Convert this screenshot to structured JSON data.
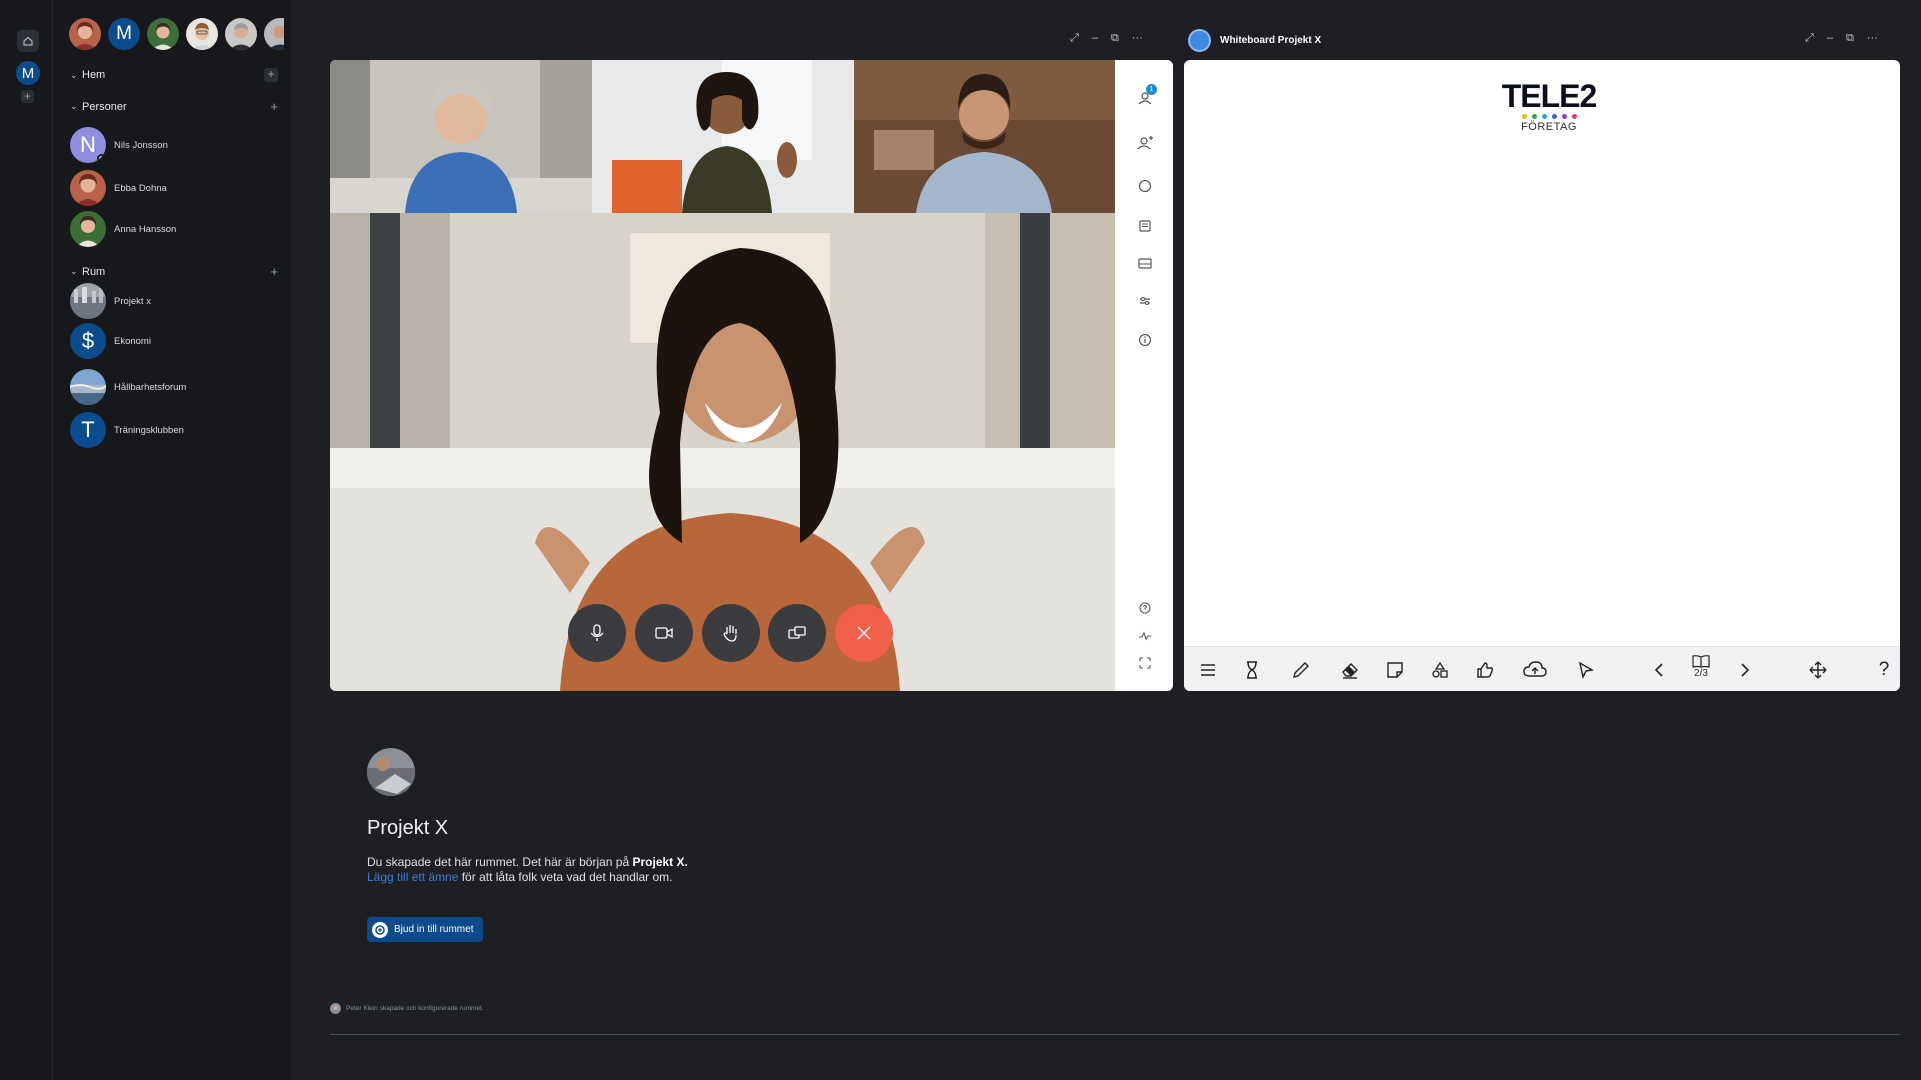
{
  "sidebar": {
    "rail_user_initial": "M",
    "top_avatar_initial": "M",
    "sections": {
      "hem": {
        "label": "Hem"
      },
      "personer": {
        "label": "Personer"
      },
      "rum": {
        "label": "Rum"
      }
    },
    "people": [
      {
        "name": "Nils Jonsson",
        "initial": "N"
      },
      {
        "name": "Ebba Dohna"
      },
      {
        "name": "Anna Hansson"
      }
    ],
    "rooms": [
      {
        "name": "Projekt x"
      },
      {
        "name": "Ekonomi",
        "icon_glyph": "$"
      },
      {
        "name": "Hållbarhetsforum"
      },
      {
        "name": "Träningsklubben",
        "initial": "T"
      }
    ]
  },
  "call": {
    "participants_badge": "1",
    "controls": [
      "microphone",
      "camera",
      "raise-hand",
      "share-screen",
      "end-call"
    ]
  },
  "whiteboard": {
    "title": "Whiteboard Projekt X",
    "logo_word": "TELE2",
    "logo_sub": "FÖRETAG",
    "page_indicator": "2/3",
    "help_label": "?",
    "logo_dot_colors": [
      "#f5b400",
      "#2da94f",
      "#29a3e0",
      "#3a5fd9",
      "#9b38c9",
      "#e23b6c"
    ]
  },
  "room": {
    "title": "Projekt X",
    "desc_prefix": "Du skapade det här rummet. Det här är början på ",
    "desc_room": "Projekt X.",
    "topic_link": "Lägg till ett ämne",
    "topic_suffix": " för att låta folk veta vad det handlar om.",
    "invite_label": "Bjud in till rummet",
    "footer_note": "Peter Klein skapade och konfigurerade rummet."
  },
  "colors": {
    "accent_blue": "#0d4a8c",
    "end_call_red": "#f0604a",
    "link_blue": "#3f7fd1"
  }
}
